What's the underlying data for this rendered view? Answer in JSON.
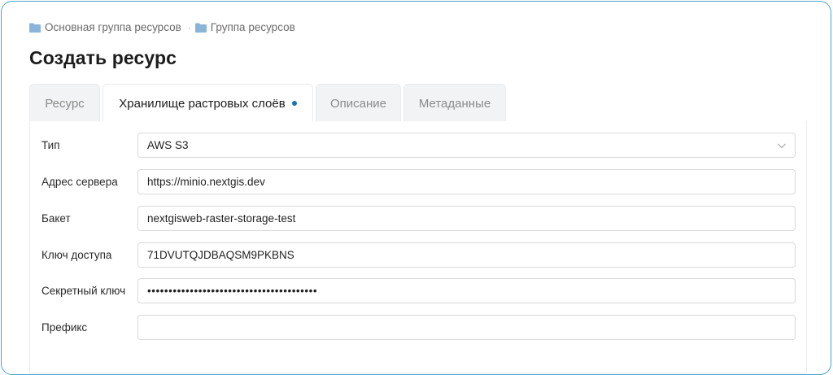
{
  "breadcrumb": {
    "items": [
      {
        "label": "Основная группа ресурсов",
        "icon": "folder-icon"
      },
      {
        "label": "Группа ресурсов",
        "icon": "folder-icon"
      }
    ],
    "separator": "·"
  },
  "page_title": "Создать ресурс",
  "tabs": [
    {
      "label": "Ресурс",
      "active": false
    },
    {
      "label": "Хранилище растровых слоёв",
      "active": true,
      "indicator": "dot"
    },
    {
      "label": "Описание",
      "active": false
    },
    {
      "label": "Метаданные",
      "active": false
    }
  ],
  "form": {
    "type": {
      "label": "Тип",
      "value": "AWS S3",
      "icon": "chevron-down-icon"
    },
    "server_address": {
      "label": "Адрес сервера",
      "value": "https://minio.nextgis.dev"
    },
    "bucket": {
      "label": "Бакет",
      "value": "nextgisweb-raster-storage-test"
    },
    "access_key": {
      "label": "Ключ доступа",
      "value": "71DVUTQJDBAQSM9PKBNS"
    },
    "secret_key": {
      "label": "Секретный ключ",
      "value": "••••••••••••••••••••••••••••••••••••••••"
    },
    "prefix": {
      "label": "Префикс",
      "value": ""
    }
  },
  "colors": {
    "accent": "#1a73b8",
    "frame_border": "#4aa3c7",
    "folder": "#8ab4d8"
  }
}
